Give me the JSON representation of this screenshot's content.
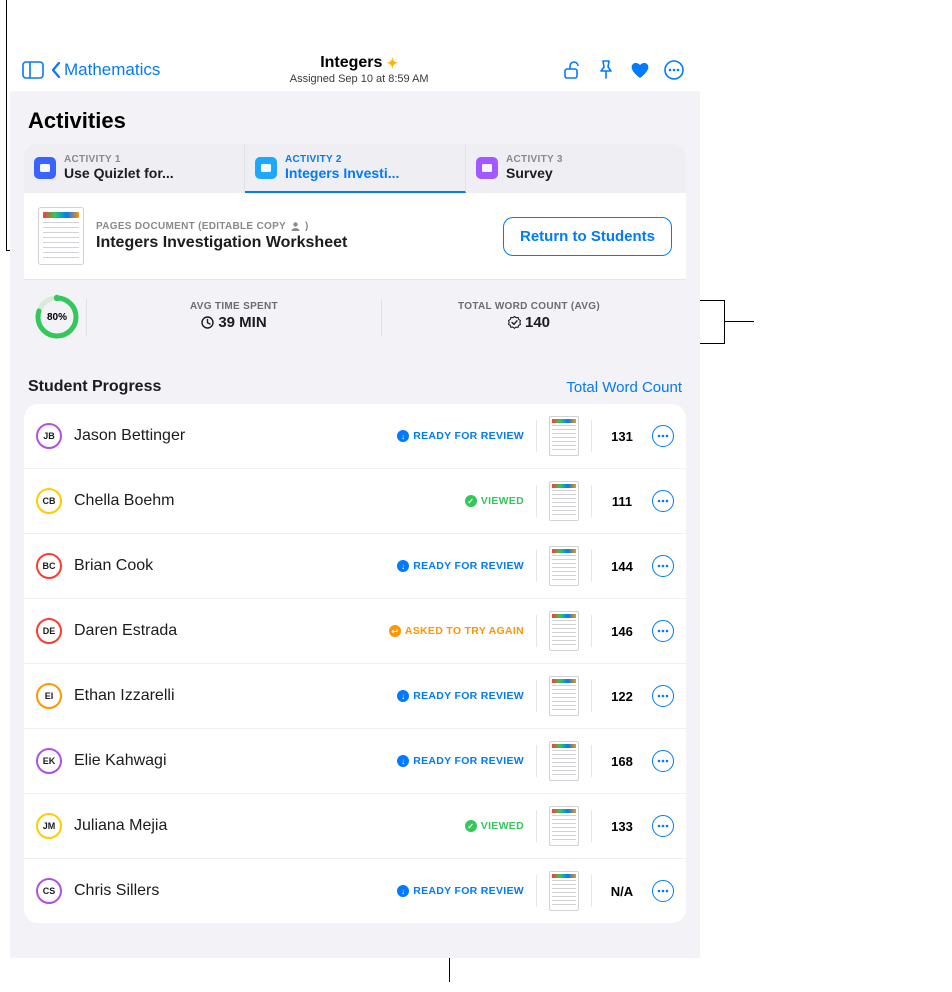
{
  "header": {
    "back_label": "Mathematics",
    "title": "Integers",
    "subtitle": "Assigned Sep 10 at 8:59 AM"
  },
  "section_title": "Activities",
  "tabs": [
    {
      "kicker": "ACTIVITY 1",
      "label": "Use Quizlet for...",
      "icon_bg": "#3a62ff",
      "active": false
    },
    {
      "kicker": "ACTIVITY 2",
      "label": "Integers Investi...",
      "icon_bg": "#1ea7ff",
      "active": true
    },
    {
      "kicker": "ACTIVITY 3",
      "label": "Survey",
      "icon_bg": "#a259ff",
      "active": false
    }
  ],
  "document": {
    "kicker": "PAGES DOCUMENT (EDITABLE COPY",
    "kicker_suffix": ")",
    "title": "Integers Investigation Worksheet",
    "return_label": "Return to Students"
  },
  "stats": {
    "progress_pct": "80%",
    "time": {
      "kicker": "AVG TIME SPENT",
      "value": "39 MIN"
    },
    "words": {
      "kicker": "TOTAL WORD COUNT (AVG)",
      "value": "140"
    }
  },
  "student_progress": {
    "label": "Student Progress",
    "sort_link": "Total Word Count"
  },
  "status_defs": {
    "ready": {
      "text": "READY FOR REVIEW",
      "color": "#007aff",
      "glyph": "↓"
    },
    "viewed": {
      "text": "VIEWED",
      "color": "#34c759",
      "glyph": "✓"
    },
    "retry": {
      "text": "ASKED TO TRY AGAIN",
      "color": "#ff9500",
      "glyph": "↩"
    }
  },
  "students": [
    {
      "initials": "JB",
      "ring": "#af52de",
      "name": "Jason Bettinger",
      "status": "ready",
      "count": "131"
    },
    {
      "initials": "CB",
      "ring": "#ffcc00",
      "name": "Chella Boehm",
      "status": "viewed",
      "count": "111"
    },
    {
      "initials": "BC",
      "ring": "#ff3b30",
      "name": "Brian Cook",
      "status": "ready",
      "count": "144"
    },
    {
      "initials": "DE",
      "ring": "#ff3b30",
      "name": "Daren Estrada",
      "status": "retry",
      "count": "146"
    },
    {
      "initials": "EI",
      "ring": "#ff9500",
      "name": "Ethan Izzarelli",
      "status": "ready",
      "count": "122"
    },
    {
      "initials": "EK",
      "ring": "#af52de",
      "name": "Elie Kahwagi",
      "status": "ready",
      "count": "168"
    },
    {
      "initials": "JM",
      "ring": "#ffcc00",
      "name": "Juliana Mejia",
      "status": "viewed",
      "count": "133"
    },
    {
      "initials": "CS",
      "ring": "#af52de",
      "name": "Chris Sillers",
      "status": "ready",
      "count": "N/A"
    }
  ]
}
